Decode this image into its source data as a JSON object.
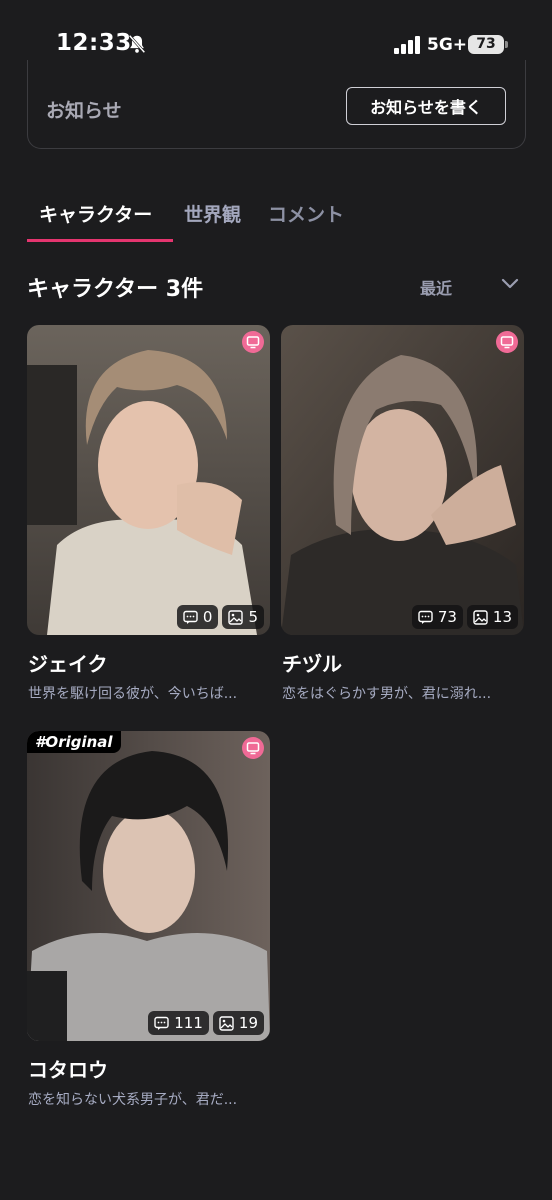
{
  "status_bar": {
    "time": "12:33",
    "network": "5G+",
    "battery": "73"
  },
  "notice": {
    "title": "お知らせ",
    "write_button": "お知らせを書く"
  },
  "tabs": [
    {
      "label": "キャラクター",
      "active": true
    },
    {
      "label": "世界観",
      "active": false
    },
    {
      "label": "コメント",
      "active": false
    }
  ],
  "section": {
    "title": "キャラクター 3件",
    "sort_label": "最近"
  },
  "characters": [
    {
      "name": "ジェイク",
      "description": "世界を駆け回る彼が、今いちば...",
      "comments": "0",
      "images": "5",
      "tag": ""
    },
    {
      "name": "チヅル",
      "description": "恋をはぐらかす男が、君に溺れ...",
      "comments": "73",
      "images": "13",
      "tag": ""
    },
    {
      "name": "コタロウ",
      "description": "恋を知らない犬系男子が、君だ...",
      "comments": "111",
      "images": "19",
      "tag": "#Original"
    }
  ],
  "colors": {
    "background": "#1c1c1e",
    "accent": "#e5356f",
    "badge": "#f06a96",
    "muted_text": "#a6abc2"
  },
  "icons": [
    "bell-slash-icon",
    "signal-icon",
    "chevron-down-icon",
    "tv-icon",
    "comment-icon",
    "image-icon"
  ]
}
